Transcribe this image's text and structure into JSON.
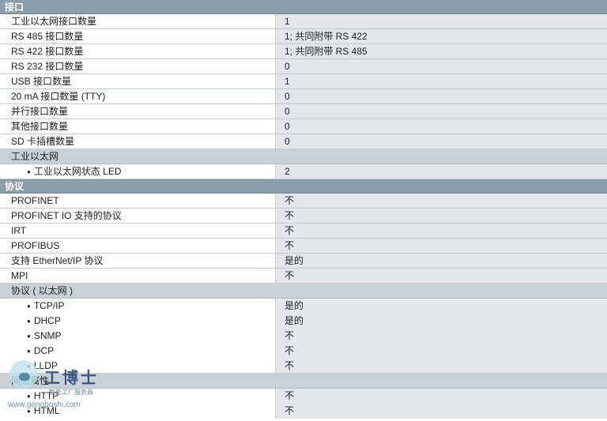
{
  "interfaces": {
    "header": "接口",
    "rows": [
      {
        "label": "工业以太网接口数量",
        "value": "1"
      },
      {
        "label": "RS 485 接口数量",
        "value": "1; 共同附带 RS 422"
      },
      {
        "label": "RS 422 接口数量",
        "value": "1; 共同附带 RS 485"
      },
      {
        "label": "RS 232 接口数量",
        "value": "0"
      },
      {
        "label": "USB 接口数量",
        "value": "1"
      },
      {
        "label": "20 mA 接口数量 (TTY)",
        "value": "0"
      },
      {
        "label": "并行接口数量",
        "value": "0"
      },
      {
        "label": "其他接口数量",
        "value": "0"
      },
      {
        "label": "SD 卡插槽数量",
        "value": "0"
      }
    ],
    "ethernet_group": "工业以太网",
    "ethernet_rows": [
      {
        "label": "工业以太网状态 LED",
        "value": "2"
      }
    ]
  },
  "protocols": {
    "header": "协议",
    "rows": [
      {
        "label": "PROFINET",
        "value": "不"
      },
      {
        "label": "PROFINET IO 支持的协议",
        "value": "不"
      },
      {
        "label": "IRT",
        "value": "不"
      },
      {
        "label": "PROFIBUS",
        "value": "不"
      },
      {
        "label": "支持 EtherNet/IP 协议",
        "value": "是的"
      },
      {
        "label": "MPI",
        "value": "不"
      }
    ],
    "ethernet_group": "协议 ( 以太网 )",
    "ethernet_rows": [
      {
        "label": "TCP/IP",
        "value": "是的"
      },
      {
        "label": "DHCP",
        "value": "是的"
      },
      {
        "label": "SNMP",
        "value": "不"
      },
      {
        "label": "DCP",
        "value": "不"
      },
      {
        "label": "LLDP",
        "value": "不"
      }
    ],
    "web_group": "网络属性",
    "web_rows": [
      {
        "label": "HTTP",
        "value": "不"
      },
      {
        "label": "HTML",
        "value": "不"
      }
    ]
  },
  "watermark": {
    "brand": "工博士",
    "tagline": "智能工厂服务商",
    "url": "www.gongboshi.com",
    "logo_icon": "robot-mascot-icon"
  }
}
